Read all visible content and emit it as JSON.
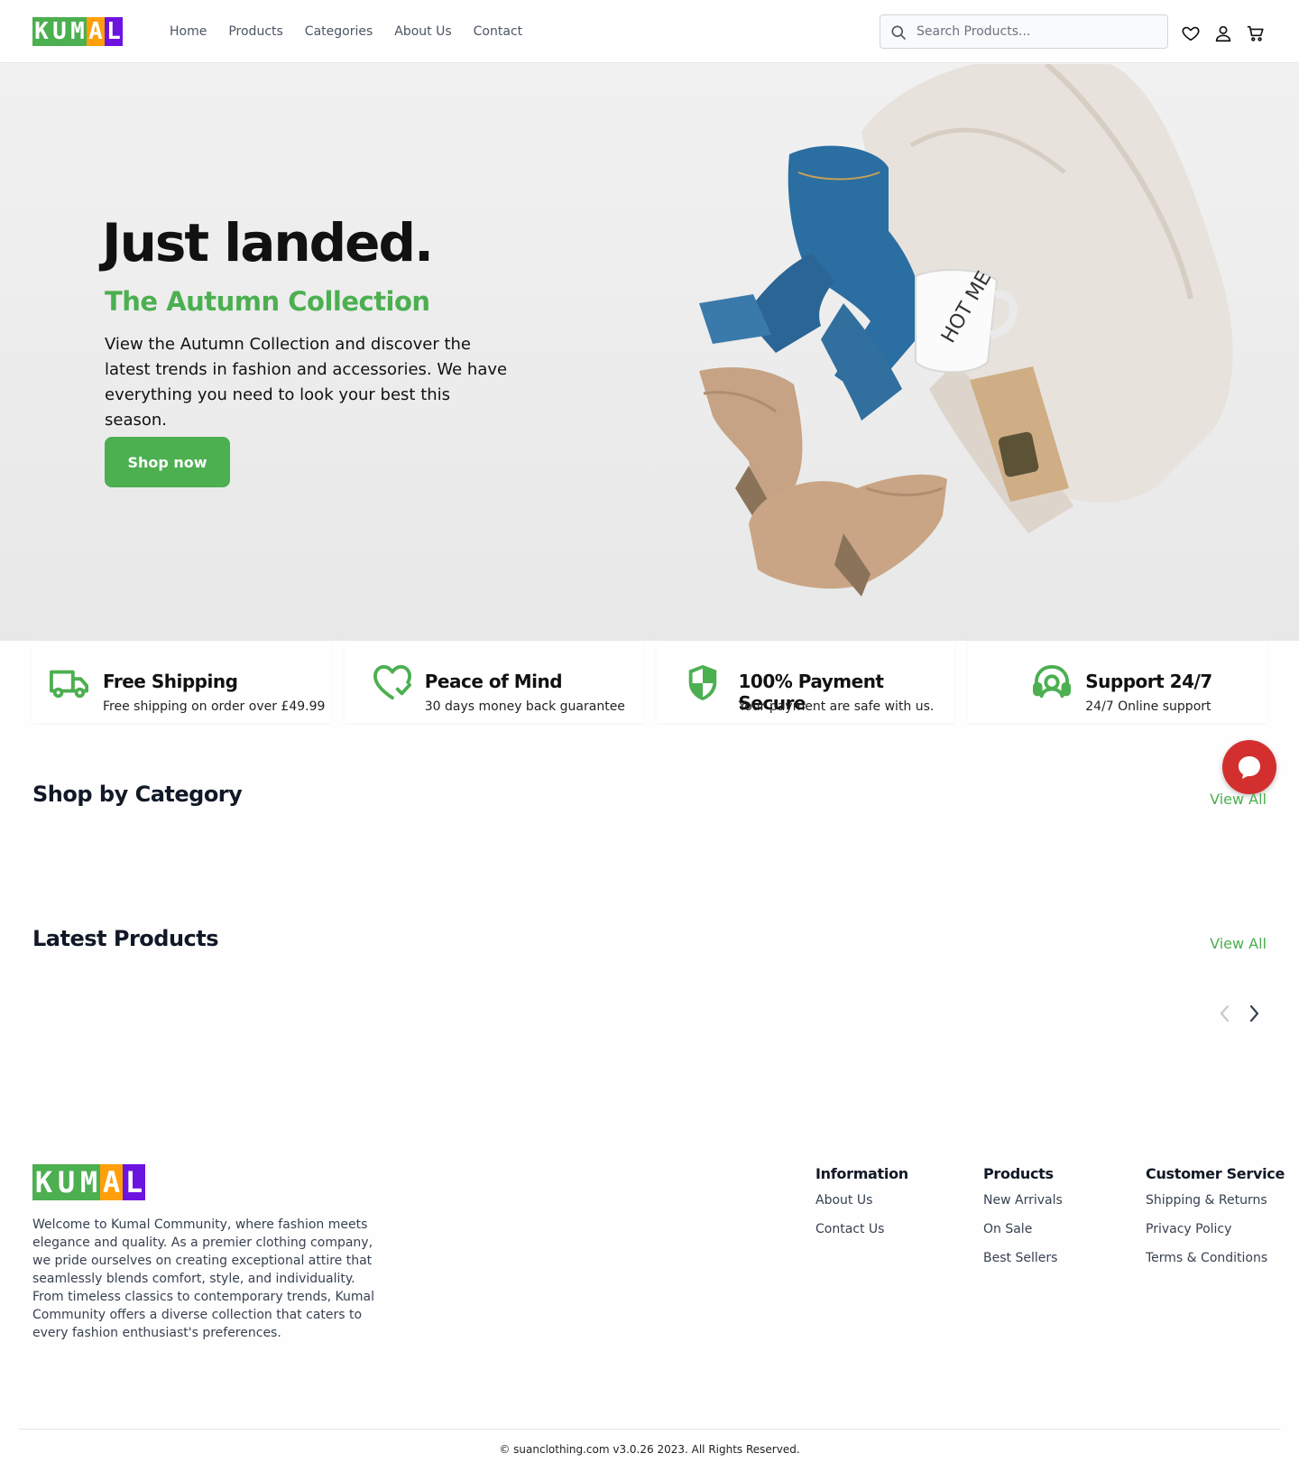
{
  "brand": {
    "logo_letters": [
      "K",
      "U",
      "M",
      "A",
      "L"
    ],
    "logo_colors": [
      "#4caf50",
      "#4caf50",
      "#4caf50",
      "#ff9f0a",
      "#6d13e0"
    ]
  },
  "nav": {
    "items": [
      "Home",
      "Products",
      "Categories",
      "About Us",
      "Contact"
    ]
  },
  "search": {
    "placeholder": "Search Products..."
  },
  "header_icons": [
    "heart-icon",
    "user-icon",
    "cart-icon"
  ],
  "hero": {
    "title": "Just landed.",
    "subtitle": "The Autumn Collection",
    "text": "View the Autumn Collection and discover the latest trends in fashion and accessories. We have everything you need to look your best this season.",
    "cta": "Shop now"
  },
  "features": [
    {
      "icon": "truck-icon",
      "title": "Free Shipping",
      "desc": "Free shipping on order over £49.99"
    },
    {
      "icon": "heart-check-icon",
      "title": "Peace of Mind",
      "desc": "30 days money back guarantee"
    },
    {
      "icon": "shield-icon",
      "title": "100% Payment Secure",
      "desc": "Your payment are safe with us."
    },
    {
      "icon": "headset-icon",
      "title": "Support 24/7",
      "desc": "24/7 Online support"
    }
  ],
  "sections": {
    "categories_title": "Shop by Category",
    "products_title": "Latest Products",
    "view_all": "View All"
  },
  "footer": {
    "about": "Welcome to Kumal Community, where fashion meets elegance and quality. As a premier clothing company, we pride ourselves on creating exceptional attire that seamlessly blends comfort, style, and individuality. From timeless classics to contemporary trends, Kumal Community offers a diverse collection that caters to every fashion enthusiast's preferences.",
    "columns": [
      {
        "title": "Information",
        "links": [
          "About Us",
          "Contact Us"
        ]
      },
      {
        "title": "Products",
        "links": [
          "New Arrivals",
          "On Sale",
          "Best Sellers"
        ]
      },
      {
        "title": "Customer Service",
        "links": [
          "Shipping & Returns",
          "Privacy Policy",
          "Terms & Conditions"
        ]
      }
    ],
    "copyright": "© suanclothing.com v3.0.26 2023. All Rights Reserved."
  },
  "colors": {
    "accent": "#4caf50",
    "chat": "#d32f2f"
  }
}
